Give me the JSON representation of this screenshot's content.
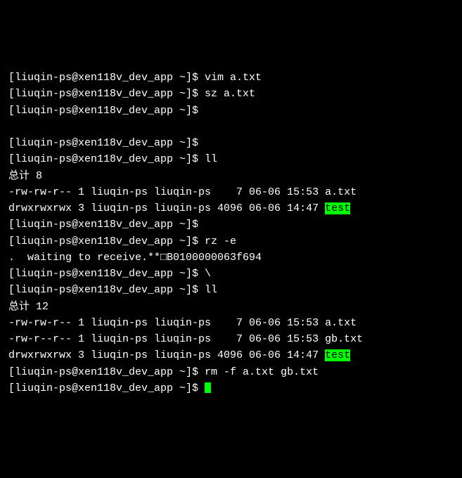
{
  "lines": [
    {
      "segments": [
        {
          "t": "[liuqin-ps@xen118v_dev_app ~]$ vim a.txt"
        }
      ]
    },
    {
      "segments": [
        {
          "t": "[liuqin-ps@xen118v_dev_app ~]$ sz a.txt"
        }
      ]
    },
    {
      "segments": [
        {
          "t": "[liuqin-ps@xen118v_dev_app ~]$"
        }
      ]
    },
    {
      "segments": [
        {
          "t": " "
        }
      ]
    },
    {
      "segments": [
        {
          "t": "[liuqin-ps@xen118v_dev_app ~]$"
        }
      ]
    },
    {
      "segments": [
        {
          "t": "[liuqin-ps@xen118v_dev_app ~]$ ll"
        }
      ]
    },
    {
      "segments": [
        {
          "t": "总计 8"
        }
      ]
    },
    {
      "segments": [
        {
          "t": "-rw-rw-r-- 1 liuqin-ps liuqin-ps    7 06-06 15:53 a.txt"
        }
      ]
    },
    {
      "segments": [
        {
          "t": "drwxrwxrwx 3 liuqin-ps liuqin-ps 4096 06-06 14:47 "
        },
        {
          "t": "test",
          "hl": true
        }
      ]
    },
    {
      "segments": [
        {
          "t": "[liuqin-ps@xen118v_dev_app ~]$"
        }
      ]
    },
    {
      "segments": [
        {
          "t": "[liuqin-ps@xen118v_dev_app ~]$ rz -e"
        }
      ]
    },
    {
      "segments": [
        {
          "t": ".  waiting to receive.**□B0100000063f694"
        }
      ]
    },
    {
      "segments": [
        {
          "t": "[liuqin-ps@xen118v_dev_app ~]$ \\"
        }
      ]
    },
    {
      "segments": [
        {
          "t": "[liuqin-ps@xen118v_dev_app ~]$ ll"
        }
      ]
    },
    {
      "segments": [
        {
          "t": "总计 12"
        }
      ]
    },
    {
      "segments": [
        {
          "t": "-rw-rw-r-- 1 liuqin-ps liuqin-ps    7 06-06 15:53 a.txt"
        }
      ]
    },
    {
      "segments": [
        {
          "t": "-rw-r--r-- 1 liuqin-ps liuqin-ps    7 06-06 15:53 gb.txt"
        }
      ]
    },
    {
      "segments": [
        {
          "t": "drwxrwxrwx 3 liuqin-ps liuqin-ps 4096 06-06 14:47 "
        },
        {
          "t": "test",
          "hl": true
        }
      ]
    },
    {
      "segments": [
        {
          "t": "[liuqin-ps@xen118v_dev_app ~]$ rm -f a.txt gb.txt"
        }
      ]
    },
    {
      "segments": [
        {
          "t": "[liuqin-ps@xen118v_dev_app ~]$ "
        },
        {
          "cursor": true
        }
      ]
    }
  ]
}
